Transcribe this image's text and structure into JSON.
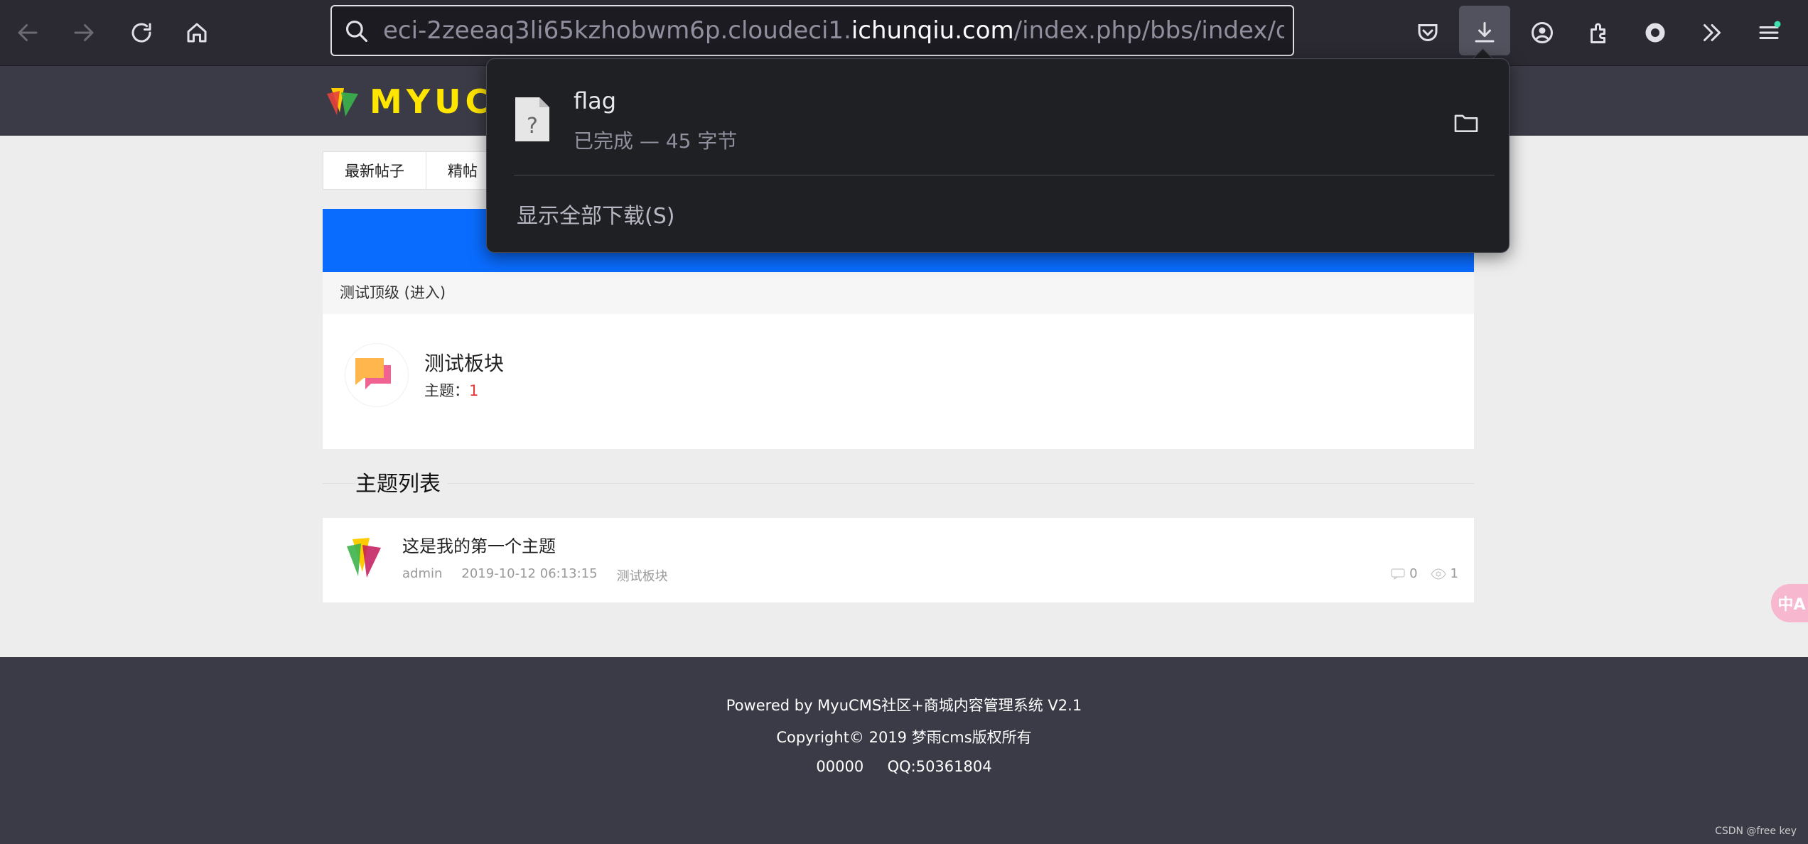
{
  "browser": {
    "url_prefix": "eci-2zeeaq3li65kzhobwm6p.cloudeci1.",
    "url_domain": "ichunqiu.com",
    "url_suffix": "/index.php/bbs/index/downloa"
  },
  "site": {
    "logo_text": "MYUC",
    "tabs": [
      "最新帖子",
      "精帖"
    ]
  },
  "forum": {
    "category_label": "测试顶级 (进入)",
    "board_name": "测试板块",
    "topics_label": "主题：",
    "topics_count": "1"
  },
  "topic_list": {
    "title": "主题列表",
    "items": [
      {
        "title": "这是我的第一个主题",
        "author": "admin",
        "time": "2019-10-12 06:13:15",
        "board": "测试板块",
        "replies": "0",
        "views": "1"
      }
    ]
  },
  "footer": {
    "line1": "Powered by MyuCMS社区+商城内容管理系统 V2.1",
    "line2": "Copyright© 2019 梦雨cms版权所有",
    "line3": "00000     QQ:50361804"
  },
  "watermark": "CSDN @free key",
  "translate_label": "中A",
  "downloads": {
    "file_name": "flag",
    "status": "已完成 — 45 字节",
    "show_all": "显示全部下载(S)"
  },
  "colors": {
    "banner_blue": "#0a6cff",
    "header_bg": "#3a3b46",
    "logo_yellow": "#ffe500"
  }
}
